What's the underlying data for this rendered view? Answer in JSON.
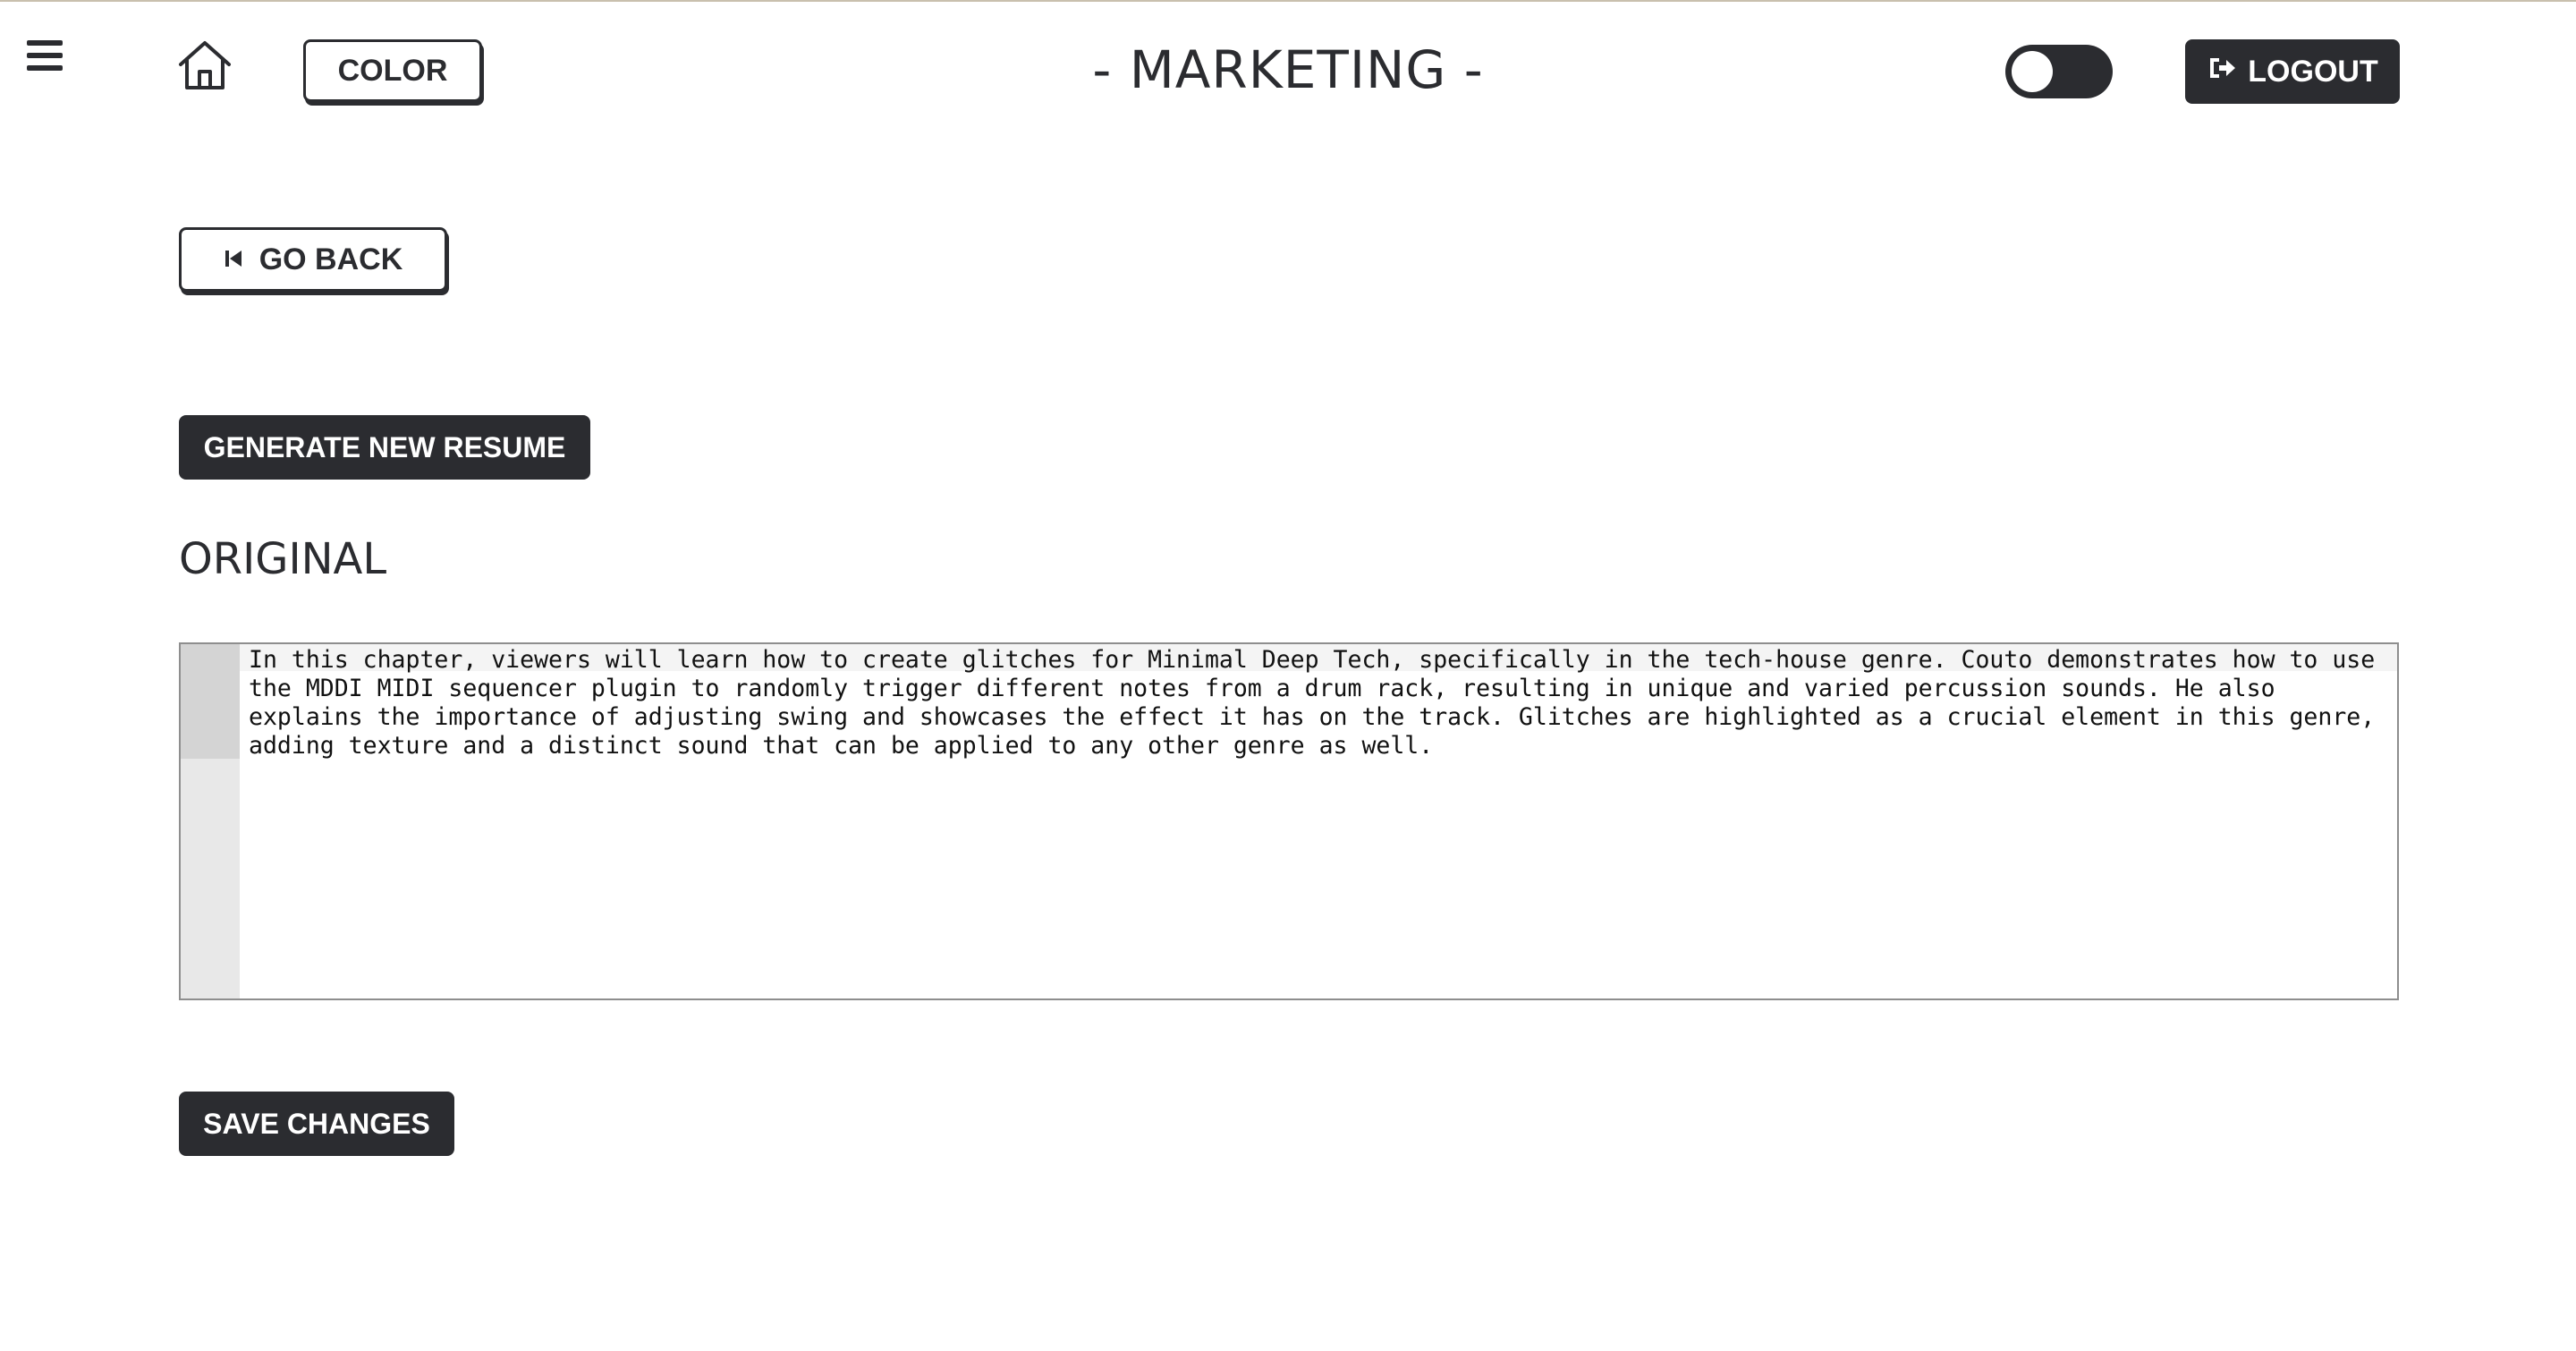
{
  "header": {
    "menu_icon": "hamburger-menu-icon",
    "home_icon": "home-icon",
    "color_button_label": "COLOR",
    "title": "- MARKETING -",
    "theme_toggle": {
      "state": "off"
    },
    "logout_label": "LOGOUT",
    "logout_icon": "sign-out-icon"
  },
  "main": {
    "go_back_label": "GO BACK",
    "go_back_icon": "skip-back-icon",
    "generate_label": "GENERATE NEW RESUME",
    "section_heading": "ORIGINAL",
    "editor_text": "In this chapter, viewers will learn how to create glitches for Minimal Deep Tech, specifically in the tech-house genre. Couto demonstrates how to use the MDDI MIDI sequencer plugin to randomly trigger different notes from a drum rack, resulting in unique and varied percussion sounds. He also explains the importance of adjusting swing and showcases the effect it has on the track. Glitches are highlighted as a crucial element in this genre, adding texture and a distinct sound that can be applied to any other genre as well.",
    "save_label": "SAVE CHANGES"
  },
  "colors": {
    "primary_dark": "#2b2c30",
    "background": "#ffffff",
    "editor_gutter": "#e8e8e8"
  }
}
